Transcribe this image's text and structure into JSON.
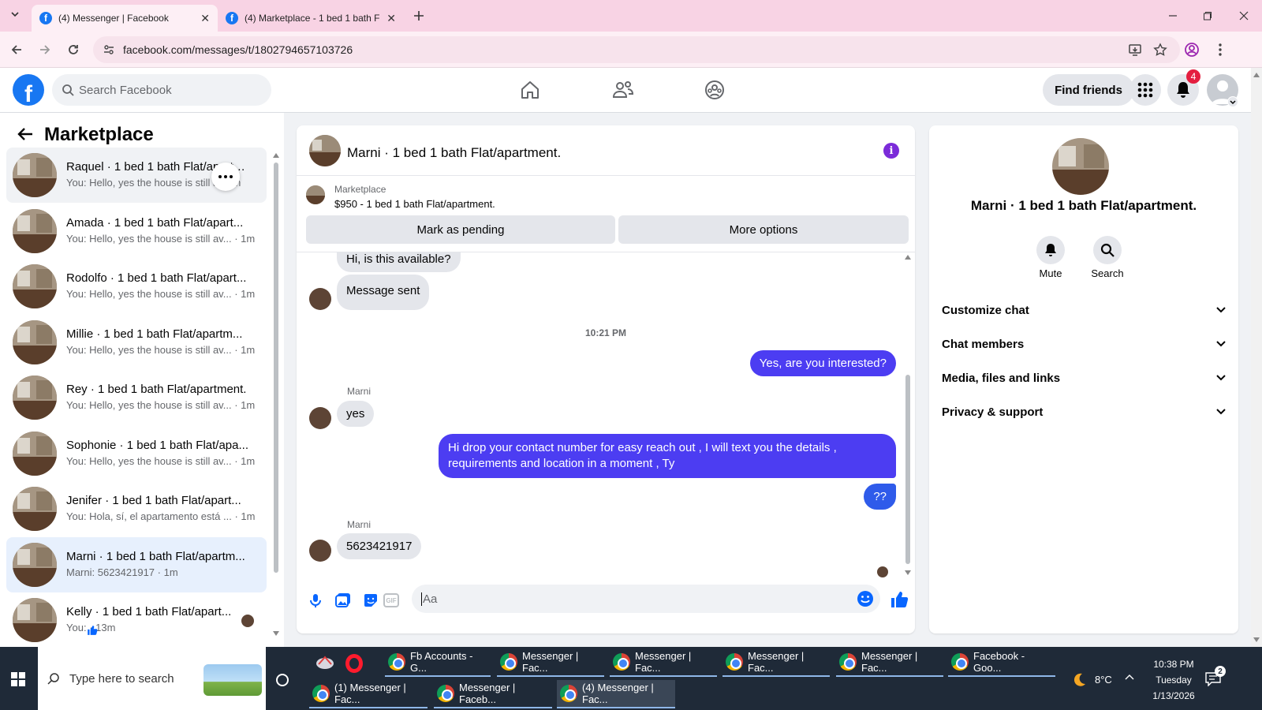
{
  "browser": {
    "tabs": [
      {
        "title": "(4) Messenger | Facebook",
        "active": true
      },
      {
        "title": "(4) Marketplace - 1 bed 1 bath F",
        "active": false
      }
    ],
    "url": "facebook.com/messages/t/1802794657103726"
  },
  "header": {
    "search_placeholder": "Search Facebook",
    "find_friends": "Find friends",
    "notification_count": "4"
  },
  "sidebar": {
    "title": "Marketplace",
    "conversations": [
      {
        "name": "Raquel · 1 bed 1 bath Flat/apartment.",
        "preview": "You: Hello, yes the house is still av",
        "time": "1m"
      },
      {
        "name": "Amada · 1 bed 1 bath Flat/apart...",
        "preview": "You: Hello, yes the house is still av...",
        "time": "· 1m"
      },
      {
        "name": "Rodolfo · 1 bed 1 bath Flat/apart...",
        "preview": "You: Hello, yes the house is still av...",
        "time": "· 1m"
      },
      {
        "name": "Millie · 1 bed 1 bath Flat/apartm...",
        "preview": "You: Hello, yes the house is still av...",
        "time": "· 1m"
      },
      {
        "name": "Rey · 1 bed 1 bath Flat/apartment.",
        "preview": "You: Hello, yes the house is still av...",
        "time": "· 1m"
      },
      {
        "name": "Sophonie · 1 bed 1 bath Flat/apa...",
        "preview": "You: Hello, yes the house is still av...",
        "time": "· 1m"
      },
      {
        "name": "Jenifer · 1 bed 1 bath Flat/apart...",
        "preview": "You: Hola, sí, el apartamento está ...",
        "time": "· 1m"
      },
      {
        "name": "Marni · 1 bed 1 bath Flat/apartm...",
        "preview": "Marni: 5623421917 · 1m",
        "time": ""
      },
      {
        "name": "Kelly · 1 bed 1 bath Flat/apart...",
        "preview": "You:",
        "time": "· 13m"
      }
    ]
  },
  "chat": {
    "title": "Marni · 1 bed 1 bath Flat/apartment.",
    "listing_label": "Marketplace",
    "listing_price": "$950 - 1 bed 1 bath Flat/apartment.",
    "mark_pending": "Mark as pending",
    "more_options": "More options",
    "messages": {
      "m1": "Hi, is this available?",
      "m2": "Message sent",
      "timestamp": "10:21 PM",
      "m3": "Yes, are you interested?",
      "sender1": "Marni",
      "m4": "yes",
      "m5": "Hi drop your contact number for easy reach out , I will text you the details , requirements and location in a moment , Ty",
      "m6": "??",
      "sender2": "Marni",
      "m7": "5623421917"
    },
    "composer_placeholder": "Aa"
  },
  "details": {
    "name": "Marni · 1 bed 1 bath Flat/apartment.",
    "mute": "Mute",
    "search": "Search",
    "sections": [
      "Customize chat",
      "Chat members",
      "Media, files and links",
      "Privacy & support"
    ]
  },
  "taskbar": {
    "search_placeholder": "Type here to search",
    "apps_row1": [
      "Fb Accounts - G...",
      "Messenger | Fac...",
      "Messenger | Fac...",
      "Messenger | Fac...",
      "Messenger | Fac...",
      "Facebook - Goo..."
    ],
    "apps_row2": [
      "(1) Messenger | Fac...",
      "Messenger | Faceb...",
      "(4) Messenger | Fac..."
    ],
    "weather": "8°C",
    "time": "10:38 PM",
    "day": "Tuesday",
    "date": "1/13/2026"
  },
  "colors": {
    "accent": "#4c3df2",
    "fb_blue": "#1877f2",
    "tab_strip": "#f8d3e4"
  }
}
